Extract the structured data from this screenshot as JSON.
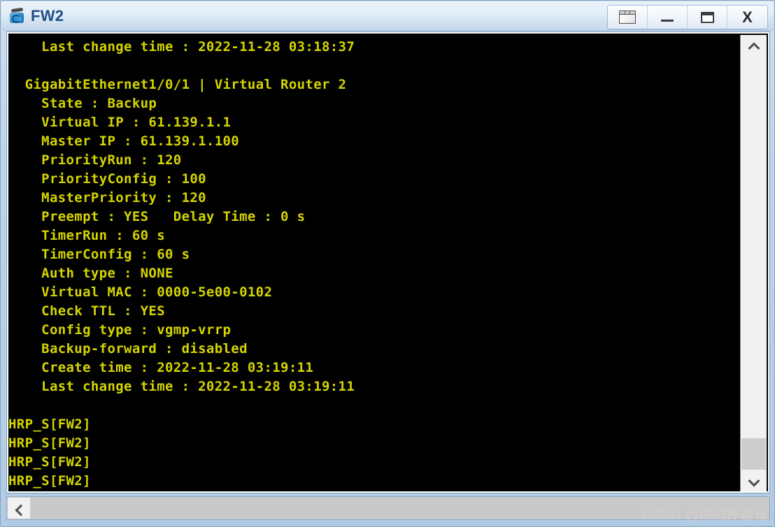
{
  "window": {
    "title": "FW2",
    "icon": "firewall-icon",
    "controls": [
      {
        "name": "restore-layout-button",
        "label": "",
        "glyph": "layout"
      },
      {
        "name": "minimize-button",
        "label": "",
        "glyph": "minimize"
      },
      {
        "name": "maximize-button",
        "label": "",
        "glyph": "maximize"
      },
      {
        "name": "close-button",
        "label": "X",
        "glyph": "close"
      }
    ]
  },
  "terminal": {
    "foreground_color": "#d5d500",
    "background_color": "#000000",
    "lines": [
      "    Last change time : 2022-11-28 03:18:37",
      "",
      "  GigabitEthernet1/0/1 | Virtual Router 2",
      "    State : Backup",
      "    Virtual IP : 61.139.1.1",
      "    Master IP : 61.139.1.100",
      "    PriorityRun : 120",
      "    PriorityConfig : 100",
      "    MasterPriority : 120",
      "    Preempt : YES   Delay Time : 0 s",
      "    TimerRun : 60 s",
      "    TimerConfig : 60 s",
      "    Auth type : NONE",
      "    Virtual MAC : 0000-5e00-0102",
      "    Check TTL : YES",
      "    Config type : vgmp-vrrp",
      "    Backup-forward : disabled",
      "    Create time : 2022-11-28 03:19:11",
      "    Last change time : 2022-11-28 03:19:11",
      "",
      "HRP_S[FW2]",
      "HRP_S[FW2]",
      "HRP_S[FW2]",
      "HRP_S[FW2]"
    ]
  },
  "scrollbars": {
    "vertical": {
      "up_arrow": "⌃",
      "down_arrow": "⌄"
    },
    "horizontal": {
      "left_arrow": "‹"
    }
  },
  "watermark": {
    "text": "CSDN @你的好爸爸"
  }
}
